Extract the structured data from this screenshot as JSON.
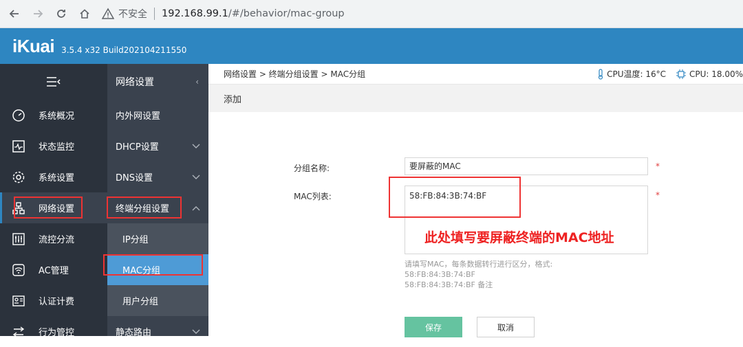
{
  "browser": {
    "insecure_label": "不安全",
    "url_host": "192.168.99.1",
    "url_path": "/#/behavior/mac-group"
  },
  "header": {
    "logo": "iKuai",
    "version": "3.5.4 x32 Build202104211550"
  },
  "leftnav": {
    "items": [
      {
        "label": "系统概况",
        "icon": "dashboard-icon"
      },
      {
        "label": "状态监控",
        "icon": "monitor-icon"
      },
      {
        "label": "系统设置",
        "icon": "gear-icon"
      },
      {
        "label": "网络设置",
        "icon": "network-icon"
      },
      {
        "label": "流控分流",
        "icon": "sliders-icon"
      },
      {
        "label": "AC管理",
        "icon": "wifi-icon"
      },
      {
        "label": "认证计费",
        "icon": "id-card-icon"
      },
      {
        "label": "行为管控",
        "icon": "arrows-icon"
      }
    ]
  },
  "subnav": {
    "title": "网络设置",
    "items": [
      {
        "label": "内外网设置"
      },
      {
        "label": "DHCP设置"
      },
      {
        "label": "DNS设置"
      },
      {
        "label": "终端分组设置"
      },
      {
        "label": "IP分组"
      },
      {
        "label": "MAC分组"
      },
      {
        "label": "用户分组"
      },
      {
        "label": "静态路由"
      }
    ]
  },
  "main": {
    "breadcrumb": "网络设置 > 终端分组设置 > MAC分组",
    "cpu_temp": "CPU温度: 16°C",
    "cpu_usage": "CPU: 18.00%",
    "section_title": "添加",
    "form": {
      "group_name_label": "分组名称:",
      "group_name_value": "要屏蔽的MAC",
      "mac_list_label": "MAC列表:",
      "mac_list_value": "58:FB:84:3B:74:BF",
      "required_mark": "*",
      "hint_line1": "请填写MAC，每条数据转行进行区分，格式:",
      "hint_line2": "58:FB:84:3B:74:BF",
      "hint_line3": "58:FB:84:3B:74:BF 备注",
      "annotation": "此处填写要屏蔽终端的MAC地址",
      "save_label": "保存",
      "cancel_label": "取消"
    }
  },
  "colors": {
    "header_blue": "#2e86c1",
    "nav_dark": "#2b323c",
    "subnav": "#3a424e",
    "selected_blue": "#4e9bd6",
    "save_green": "#65c3a0",
    "annotation_red": "#e22222"
  }
}
